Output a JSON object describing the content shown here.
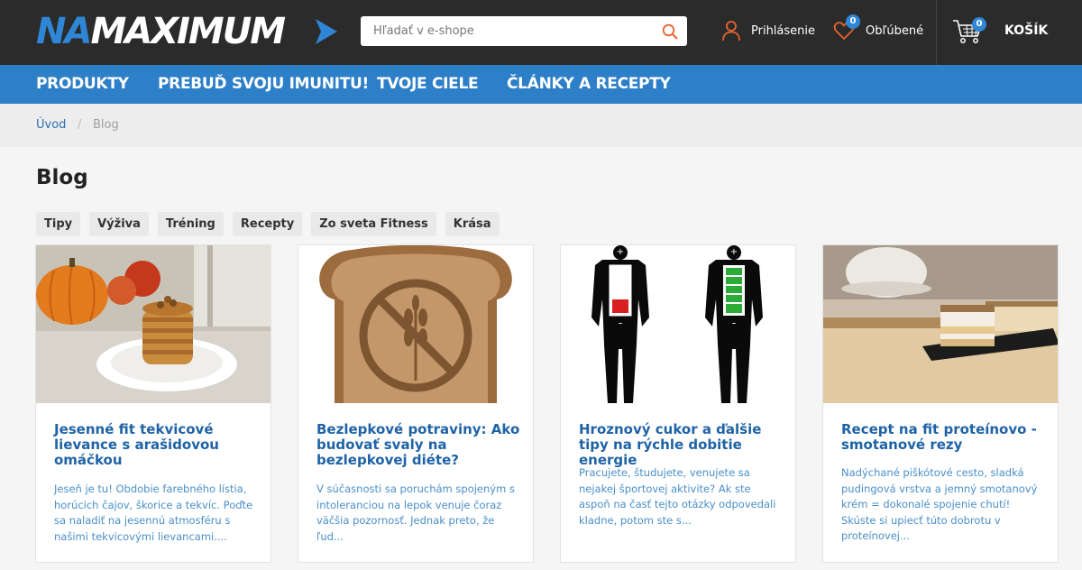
{
  "header": {
    "logo": {
      "part1": "NA",
      "part2": "MAXIMUM"
    },
    "search": {
      "placeholder": "Hľadať v e-shope",
      "value": ""
    },
    "login_label": "Prihlásenie",
    "favorites": {
      "label": "Obľúbené",
      "count": "0"
    },
    "cart": {
      "label": "KOŠÍK",
      "count": "0"
    },
    "colors": {
      "accent": "#2d7fc8",
      "icon_orange": "#e8642c",
      "topbar": "#2b2b2b"
    }
  },
  "nav": {
    "items": [
      "PRODUKTY",
      "PREBUĎ SVOJU IMUNITU!",
      "TVOJE CIELE",
      "ČLÁNKY A RECEPTY"
    ]
  },
  "breadcrumb": {
    "home": "Úvod",
    "separator": "/",
    "current": "Blog"
  },
  "page": {
    "title": "Blog"
  },
  "tags": [
    "Tipy",
    "Výživa",
    "Tréning",
    "Recepty",
    "Zo sveta Fitness",
    "Krása"
  ],
  "cards": [
    {
      "title": "Jesenné fit tekvicové lievance s arašidovou omáčkou",
      "excerpt": "Jeseň je tu! Obdobie farebného lístia, horúcich čajov, škorice a tekvíc. Poďte sa naladiť na jesennú atmosféru s našimi tekvicovými lievancami....",
      "image": "pumpkin-pancakes-image"
    },
    {
      "title": "Bezlepkové potraviny: Ako budovať svaly na bezlepkovej diéte?",
      "excerpt": "V súčasnosti sa poruchám spojeným s intoleranciou na lepok venuje čoraz väčšia pozornosť. Jednak preto, že ľud...",
      "image": "gluten-free-bread-image"
    },
    {
      "title": "Hroznový cukor a ďalšie tipy na rýchle dobitie energie",
      "excerpt": "Pracujete, študujete, venujete sa nejakej športovej aktivite? Ak ste aspoň na časť tejto otázky odpovedali kladne, potom ste s...",
      "image": "energy-battery-bodies-image"
    },
    {
      "title": "Recept na fit proteínovo - smotanové rezy",
      "excerpt": "Nadýchané piškótové cesto, sladká pudingová vrstva a jemný smotanový krém = dokonalé spojenie chutí! Skúste si upiecť túto dobrotu v proteínovej...",
      "image": "cream-cake-slices-image"
    }
  ]
}
